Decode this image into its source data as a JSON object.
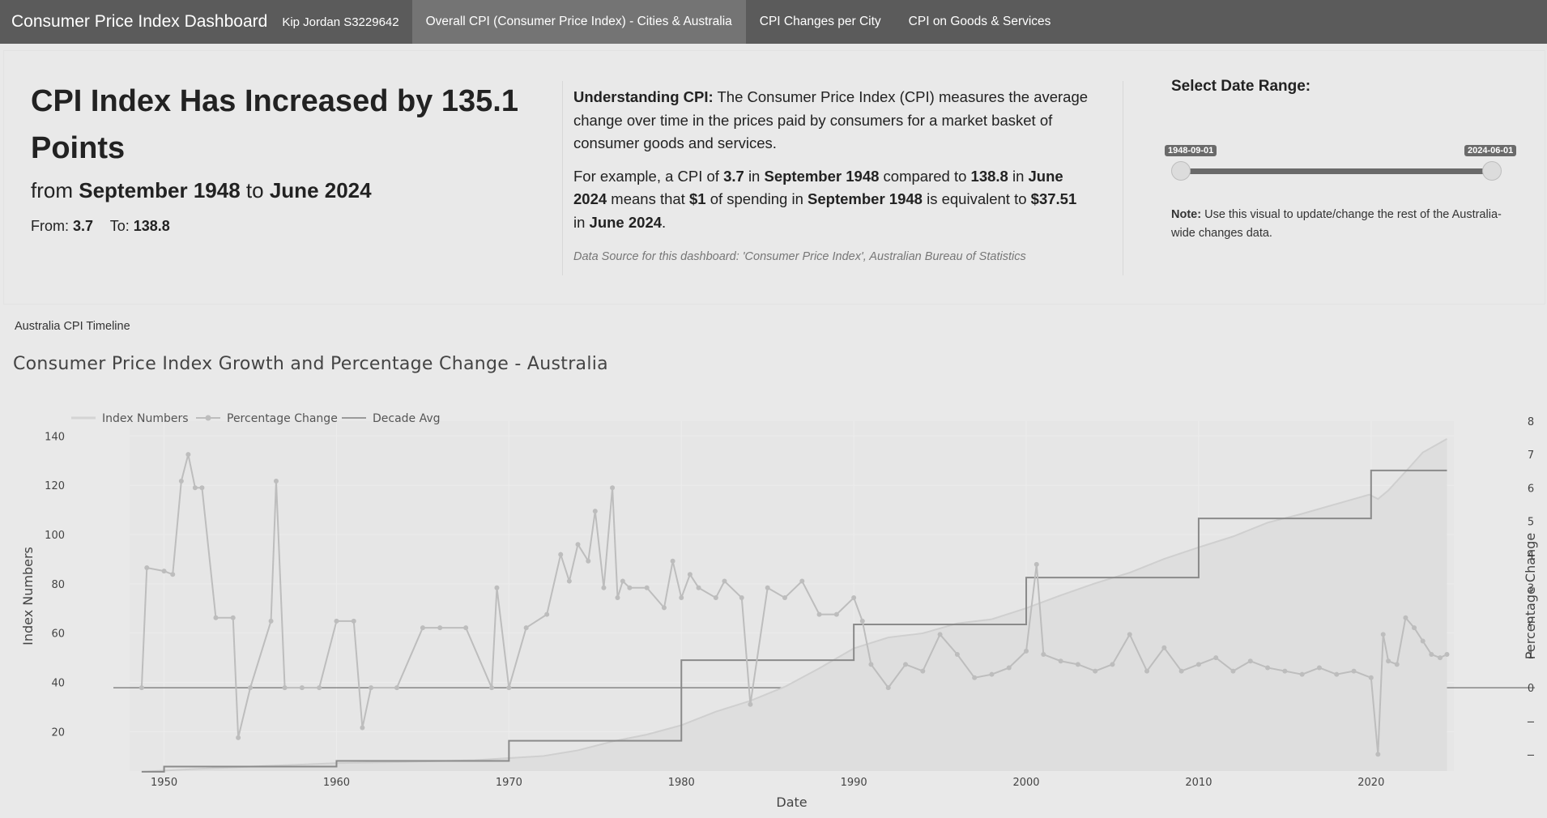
{
  "navbar": {
    "brand": "Consumer Price Index Dashboard",
    "author": "Kip Jordan S3229642",
    "tabs": [
      {
        "label": "Overall CPI (Consumer Price Index) - Cities & Australia",
        "active": true
      },
      {
        "label": "CPI Changes per City",
        "active": false
      },
      {
        "label": "CPI on Goods & Services",
        "active": false
      }
    ]
  },
  "summary": {
    "headline": "CPI Index Has Increased by 135.1 Points",
    "sub_prefix": "from",
    "sub_start": "September 1948",
    "sub_mid": "to",
    "sub_end": "June 2024",
    "from_label": "From:",
    "from_value": "3.7",
    "to_label": "To:",
    "to_value": "138.8"
  },
  "explainer": {
    "heading": "Understanding CPI:",
    "p1": "The Consumer Price Index (CPI) measures the average change over time in the prices paid by consumers for a market basket of consumer goods and services.",
    "ex_1": "For example, a CPI of",
    "ex_cpi_start": "3.7",
    "ex_2": "in",
    "ex_date_start": "September 1948",
    "ex_3": "compared to",
    "ex_cpi_end": "138.8",
    "ex_4": "in",
    "ex_date_end": "June 2024",
    "ex_5": "means that",
    "ex_dollar": "$1",
    "ex_6": "of spending in",
    "ex_date_start2": "September 1948",
    "ex_7": "is equivalent to",
    "ex_equiv": "$37.51",
    "ex_8": "in",
    "ex_date_end2": "June 2024",
    "ex_9": ".",
    "source_prefix": "Data Source for this dashboard:",
    "source_text": "'Consumer Price Index', Australian Bureau of Statistics"
  },
  "date_range": {
    "title": "Select Date Range:",
    "start": "1948-09-01",
    "end": "2024-06-01",
    "note_label": "Note:",
    "note_text": "Use this visual to update/change the rest of the Australia-wide changes data."
  },
  "card": {
    "title": "Australia CPI Timeline"
  },
  "colors": {
    "navbar": "#5b5b5b",
    "tab_active": "#747474",
    "index_line": "#cfcfcf",
    "pct_line": "#bdbdbd",
    "decade_line": "#8a8a8a",
    "background": "#e9e9e9"
  },
  "chart_data": {
    "type": "line",
    "title": "Consumer Price Index Growth and Percentage Change - Australia",
    "xlabel": "Date",
    "ylabel": "Index Numbers",
    "y2label": "Percentage Change",
    "xlim": [
      1948.0,
      2024.8
    ],
    "ylim": [
      4,
      146
    ],
    "y2lim": [
      -2.5,
      8
    ],
    "x_ticks": [
      1950,
      1960,
      1970,
      1980,
      1990,
      2000,
      2010,
      2020
    ],
    "y_ticks": [
      20,
      40,
      60,
      80,
      100,
      120,
      140
    ],
    "y2_ticks": [
      8,
      7,
      6,
      5,
      4,
      3,
      2,
      1,
      0,
      -1,
      -2
    ],
    "y2_tick_labels": [
      "8",
      "7",
      "6",
      "5",
      "4",
      "3",
      "2",
      "1",
      "0",
      "−",
      "−"
    ],
    "legend": [
      "Index Numbers",
      "Percentage Change",
      "Decade Avg"
    ],
    "legend_position": "top-left",
    "series": [
      {
        "name": "Index Numbers",
        "x": [
          1948.7,
          1952,
          1956,
          1960,
          1964,
          1968,
          1972,
          1974,
          1976,
          1978,
          1980,
          1982,
          1984,
          1986,
          1988,
          1990,
          1992,
          1994,
          1996,
          1998,
          2000,
          2002,
          2004,
          2006,
          2008,
          2010,
          2012,
          2014,
          2016,
          2018,
          2019.9,
          2020.4,
          2021,
          2022,
          2023,
          2024.4
        ],
        "y": [
          3.7,
          4.9,
          6.1,
          7.2,
          7.7,
          8.4,
          10.1,
          12.4,
          16.0,
          18.8,
          22.6,
          28.1,
          32.5,
          38.2,
          45.7,
          53.8,
          58.2,
          59.9,
          63.9,
          65.6,
          70.1,
          75.3,
          80.2,
          84.5,
          90.1,
          94.8,
          99.2,
          104.8,
          108.4,
          112.4,
          116.2,
          114.4,
          117.9,
          125.5,
          133.3,
          138.8
        ]
      },
      {
        "name": "Percentage Change",
        "x": [
          1948.7,
          1949.0,
          1950.0,
          1950.5,
          1951.0,
          1951.4,
          1951.8,
          1952.2,
          1953.0,
          1954.0,
          1954.3,
          1955.0,
          1956.2,
          1956.5,
          1957.0,
          1958.0,
          1959.0,
          1960.0,
          1961.0,
          1961.5,
          1962.0,
          1963.5,
          1965.0,
          1966.0,
          1967.5,
          1969.0,
          1969.3,
          1970.0,
          1971.0,
          1972.2,
          1973.0,
          1973.5,
          1974.0,
          1974.6,
          1975.0,
          1975.5,
          1976.0,
          1976.3,
          1976.6,
          1977.0,
          1978.0,
          1979.0,
          1979.5,
          1980.0,
          1980.5,
          1981.0,
          1982.0,
          1982.5,
          1983.5,
          1984.0,
          1985.0,
          1986.0,
          1987.0,
          1988.0,
          1989.0,
          1990.0,
          1990.5,
          1991.0,
          1992.0,
          1993.0,
          1994.0,
          1995.0,
          1996.0,
          1997.0,
          1998.0,
          1999.0,
          2000.0,
          2000.6,
          2001.0,
          2002.0,
          2003.0,
          2004.0,
          2005.0,
          2006.0,
          2007.0,
          2008.0,
          2009.0,
          2010.0,
          2011.0,
          2012.0,
          2013.0,
          2014.0,
          2015.0,
          2016.0,
          2017.0,
          2018.0,
          2019.0,
          2020.0,
          2020.4,
          2020.7,
          2021.0,
          2021.5,
          2022.0,
          2022.5,
          2023.0,
          2023.5,
          2024.0,
          2024.4
        ],
        "y": [
          0,
          3.6,
          3.5,
          3.4,
          6.2,
          7.0,
          6.0,
          6.0,
          2.1,
          2.1,
          -1.5,
          0,
          2.0,
          6.2,
          0,
          0,
          0,
          2.0,
          2.0,
          -1.2,
          0,
          0,
          1.8,
          1.8,
          1.8,
          0,
          3.0,
          0,
          1.8,
          2.2,
          4.0,
          3.2,
          4.3,
          3.8,
          5.3,
          3.0,
          6.0,
          2.7,
          3.2,
          3.0,
          3.0,
          2.4,
          3.8,
          2.7,
          3.4,
          3.0,
          2.7,
          3.2,
          2.7,
          -0.5,
          3.0,
          2.7,
          3.2,
          2.2,
          2.2,
          2.7,
          2.0,
          0.7,
          0,
          0.7,
          0.5,
          1.6,
          1.0,
          0.3,
          0.4,
          0.6,
          1.1,
          3.7,
          1.0,
          0.8,
          0.7,
          0.5,
          0.7,
          1.6,
          0.5,
          1.2,
          0.5,
          0.7,
          0.9,
          0.5,
          0.8,
          0.6,
          0.5,
          0.4,
          0.6,
          0.4,
          0.5,
          0.3,
          -2.0,
          1.6,
          0.8,
          0.7,
          2.1,
          1.8,
          1.4,
          1.0,
          0.9,
          1.0
        ]
      },
      {
        "name": "Decade Avg",
        "x": [
          1948.7,
          1950,
          1960,
          1970,
          1980,
          1990,
          2000,
          2010,
          2020,
          2024.4
        ],
        "y": [
          3.7,
          5.8,
          8.1,
          16.3,
          49.0,
          63.5,
          82.5,
          106.5,
          126.0,
          126.0
        ]
      }
    ]
  }
}
